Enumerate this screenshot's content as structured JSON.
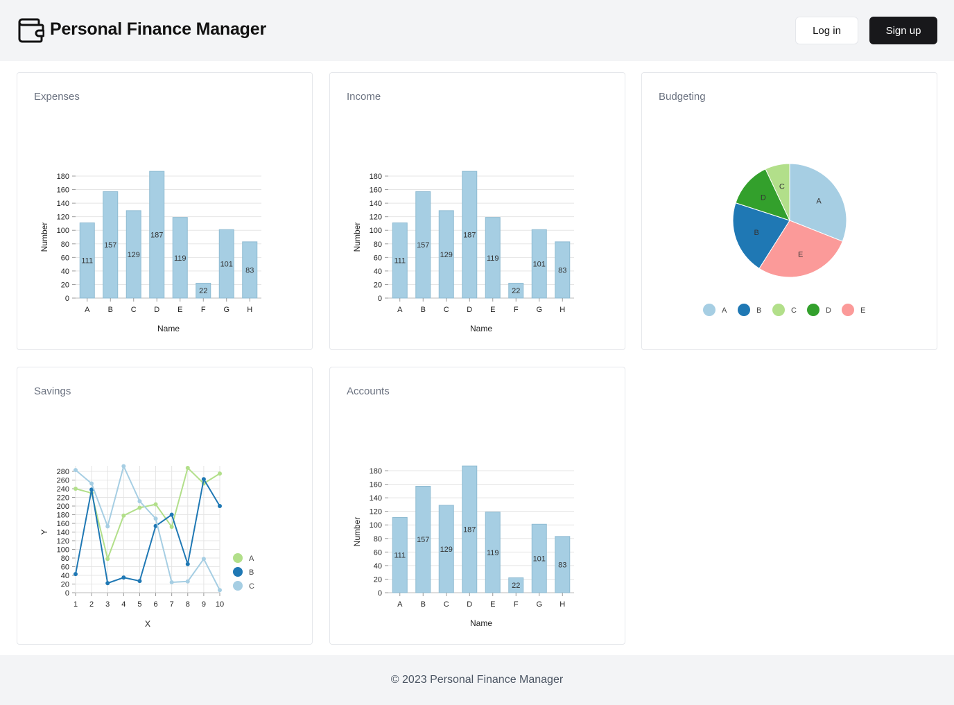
{
  "header": {
    "title": "Personal Finance Manager",
    "logo_icon": "wallet-icon",
    "login_label": "Log in",
    "signup_label": "Sign up"
  },
  "cards": {
    "expenses": {
      "title": "Expenses",
      "chart_data": {
        "type": "bar",
        "categories": [
          "A",
          "B",
          "C",
          "D",
          "E",
          "F",
          "G",
          "H"
        ],
        "values": [
          111,
          157,
          129,
          187,
          119,
          22,
          101,
          83
        ],
        "xlabel": "Name",
        "ylabel": "Number",
        "ylim": [
          0,
          180
        ],
        "yticks": [
          0,
          20,
          40,
          60,
          80,
          100,
          120,
          140,
          160,
          180
        ],
        "grid": true,
        "color": "#a6cee3"
      }
    },
    "income": {
      "title": "Income",
      "chart_data": {
        "type": "bar",
        "categories": [
          "A",
          "B",
          "C",
          "D",
          "E",
          "F",
          "G",
          "H"
        ],
        "values": [
          111,
          157,
          129,
          187,
          119,
          22,
          101,
          83
        ],
        "xlabel": "Name",
        "ylabel": "Number",
        "ylim": [
          0,
          180
        ],
        "yticks": [
          0,
          20,
          40,
          60,
          80,
          100,
          120,
          140,
          160,
          180
        ],
        "grid": true,
        "color": "#a6cee3"
      }
    },
    "budgeting": {
      "title": "Budgeting",
      "chart_data": {
        "type": "pie",
        "labels": [
          "A",
          "B",
          "C",
          "D",
          "E"
        ],
        "values": [
          31,
          21,
          7,
          13,
          28
        ],
        "order": [
          "A",
          "E",
          "B",
          "D",
          "C"
        ],
        "colors": [
          "#a6cee3",
          "#1f78b4",
          "#b2df8a",
          "#33a02c",
          "#fb9a99"
        ],
        "legend": "bottom"
      }
    },
    "savings": {
      "title": "Savings",
      "chart_data": {
        "type": "line",
        "x": [
          1,
          2,
          3,
          4,
          5,
          6,
          7,
          8,
          9,
          10
        ],
        "series": [
          {
            "name": "A",
            "color": "#b2df8a",
            "values": [
              240,
              230,
              78,
              178,
              196,
              204,
              152,
              288,
              252,
              275
            ]
          },
          {
            "name": "B",
            "color": "#1f78b4",
            "values": [
              43,
              238,
              22,
              35,
              27,
              154,
              180,
              66,
              262,
              200
            ]
          },
          {
            "name": "C",
            "color": "#a6cee3",
            "values": [
              283,
              252,
              153,
              292,
              211,
              171,
              24,
              26,
              78,
              6
            ]
          }
        ],
        "xlabel": "X",
        "ylabel": "Y",
        "ylim": [
          0,
          280
        ],
        "yticks": [
          0,
          20,
          40,
          60,
          80,
          100,
          120,
          140,
          160,
          180,
          200,
          220,
          240,
          260,
          280
        ],
        "grid": true,
        "legend": "right"
      }
    },
    "accounts": {
      "title": "Accounts",
      "chart_data": {
        "type": "bar",
        "categories": [
          "A",
          "B",
          "C",
          "D",
          "E",
          "F",
          "G",
          "H"
        ],
        "values": [
          111,
          157,
          129,
          187,
          119,
          22,
          101,
          83
        ],
        "xlabel": "Name",
        "ylabel": "Number",
        "ylim": [
          0,
          180
        ],
        "yticks": [
          0,
          20,
          40,
          60,
          80,
          100,
          120,
          140,
          160,
          180
        ],
        "grid": true,
        "color": "#a6cee3"
      }
    }
  },
  "footer": {
    "text": "© 2023 Personal Finance Manager"
  }
}
